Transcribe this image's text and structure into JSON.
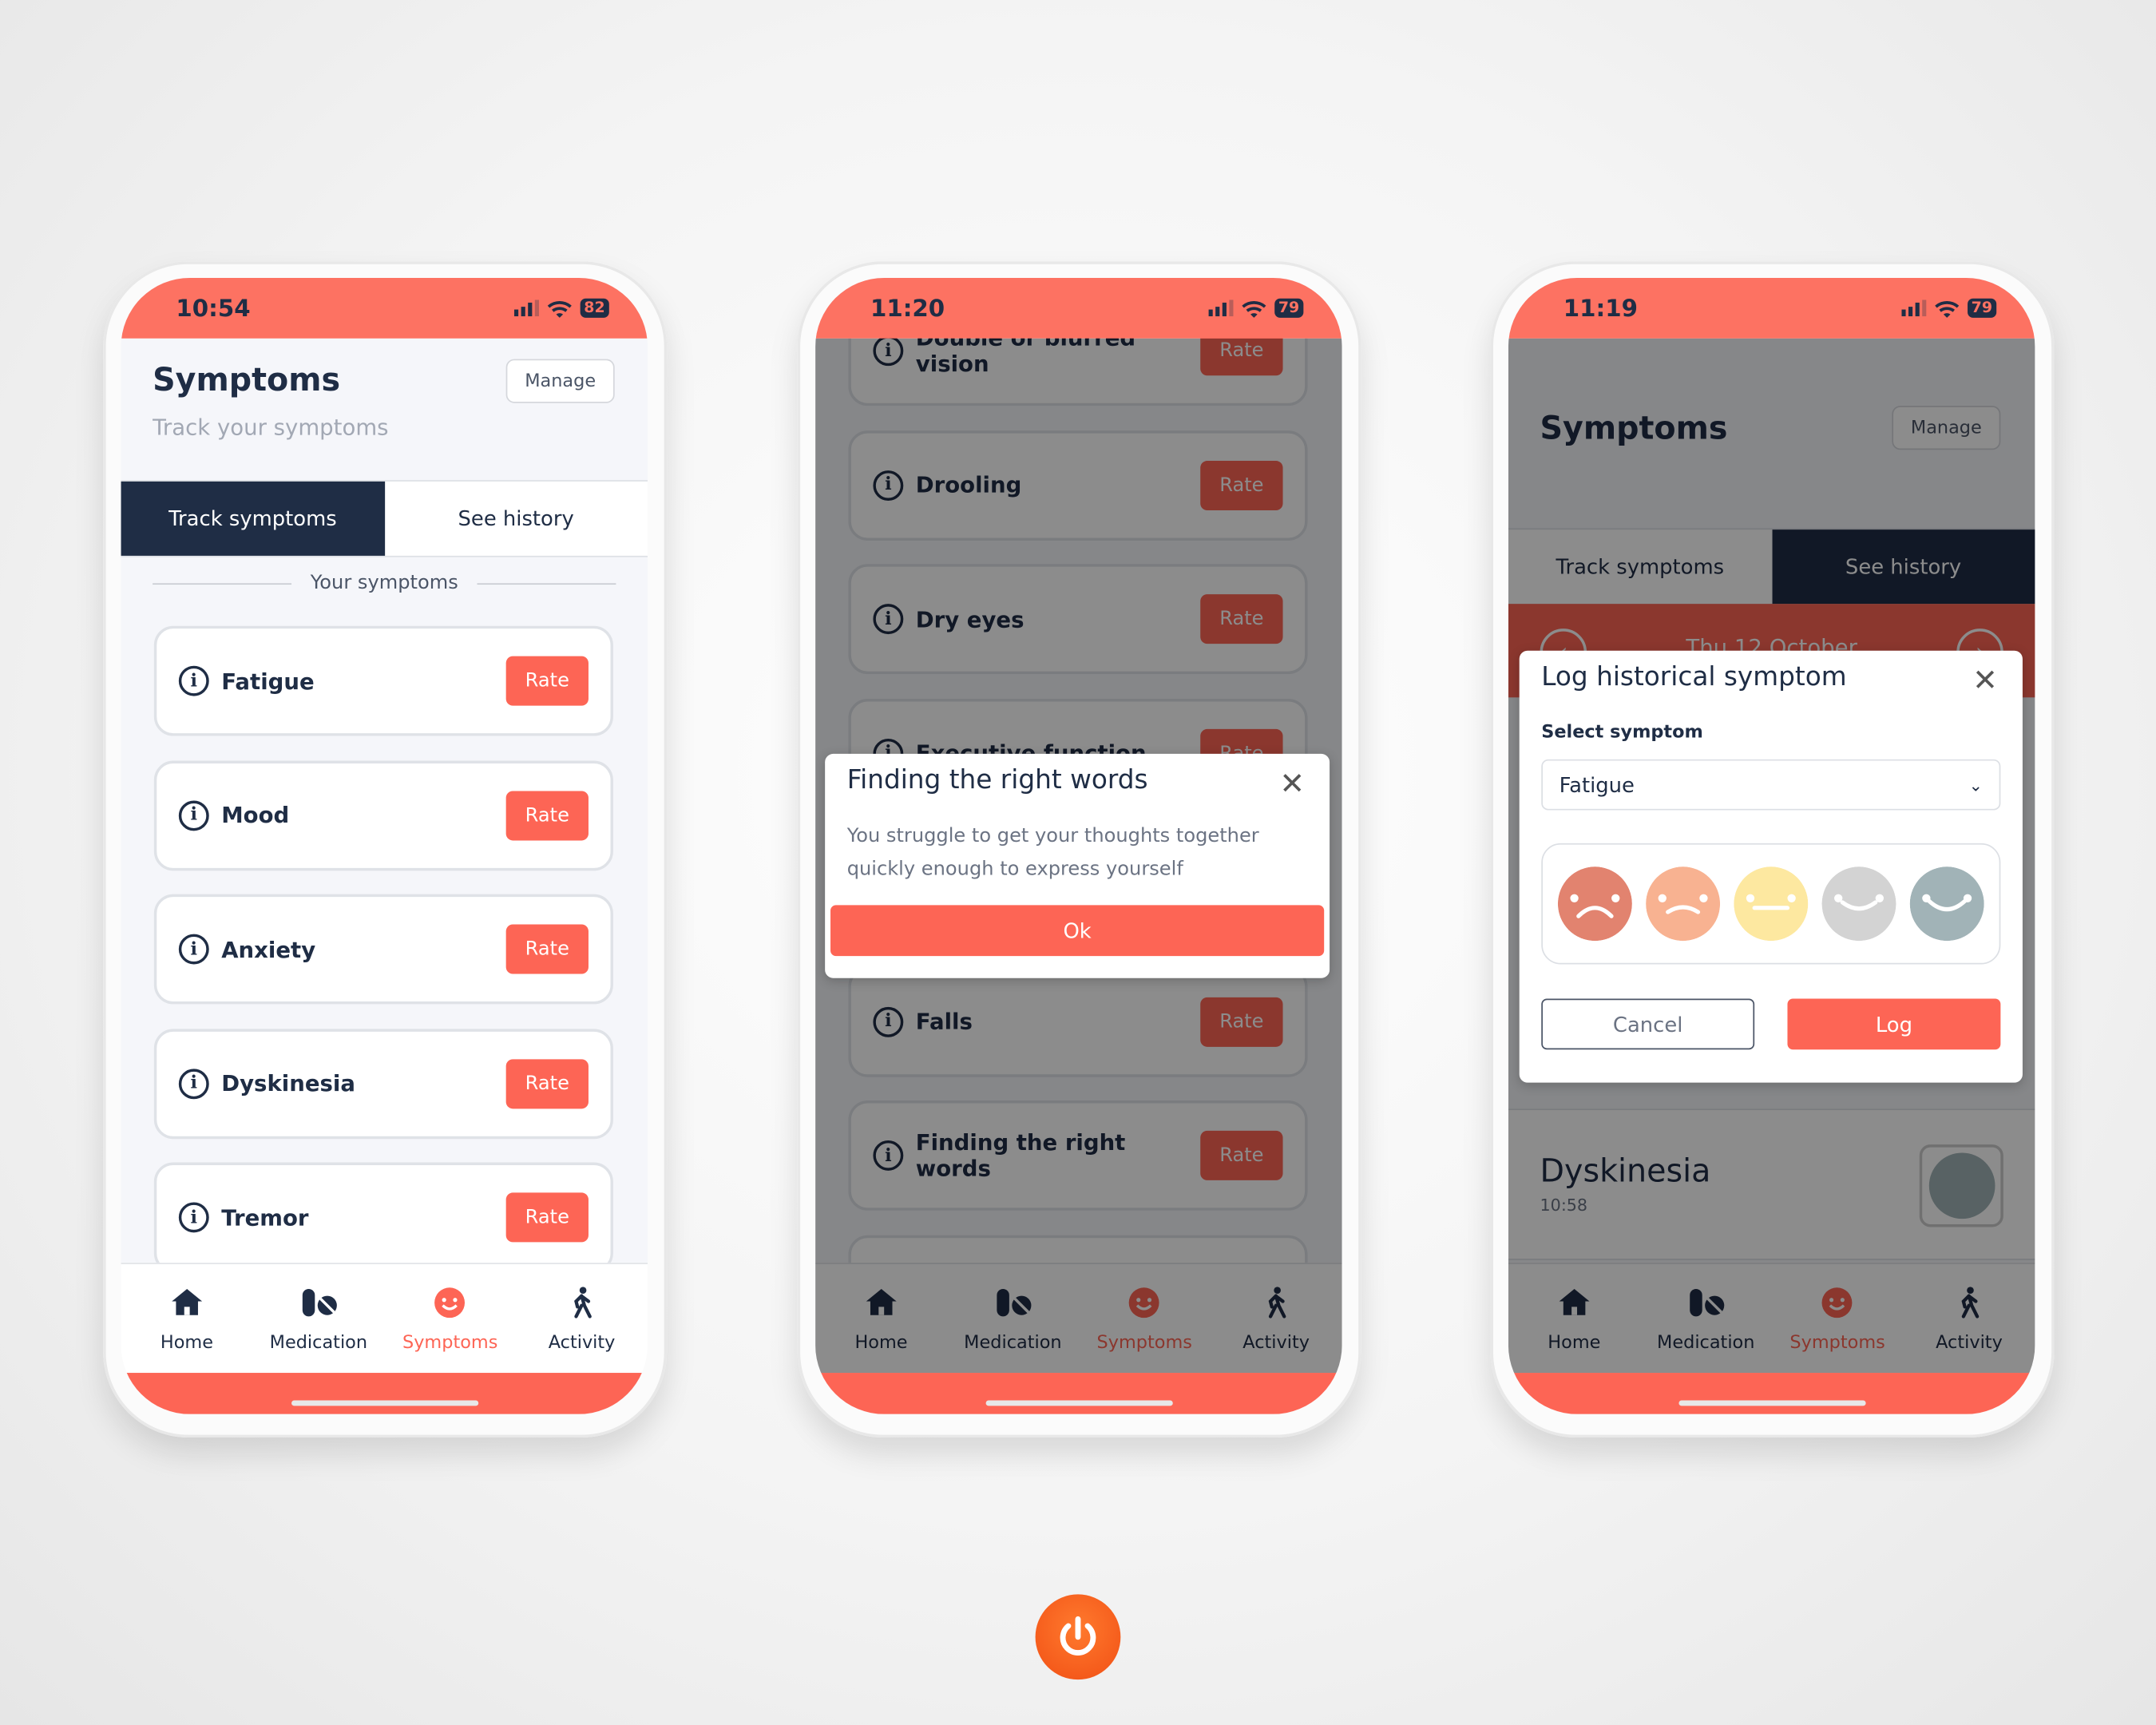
{
  "colors": {
    "accent": "#fd6555",
    "status_bar": "#fd7262",
    "navy": "#1f2d45"
  },
  "nav": [
    {
      "label": "Home",
      "icon": "home-icon"
    },
    {
      "label": "Medication",
      "icon": "pills-icon"
    },
    {
      "label": "Symptoms",
      "icon": "smiley-icon"
    },
    {
      "label": "Activity",
      "icon": "walking-icon"
    }
  ],
  "screen1": {
    "time": "10:54",
    "battery": "82",
    "title": "Symptoms",
    "subtitle": "Track your symptoms",
    "manage": "Manage",
    "tabs": [
      "Track symptoms",
      "See history"
    ],
    "active_tab": 0,
    "section": "Your symptoms",
    "rate": "Rate",
    "symptoms": [
      "Fatigue",
      "Mood",
      "Anxiety",
      "Dyskinesia",
      "Tremor"
    ]
  },
  "screen2": {
    "time": "11:20",
    "battery": "79",
    "rate": "Rate",
    "symptoms": [
      "Double or blurred vision",
      "Drooling",
      "Dry eyes",
      "Executive function",
      "",
      "Falls",
      "Finding the right words",
      ""
    ],
    "modal": {
      "title": "Finding the right words",
      "body": "You struggle to get your thoughts together quickly enough to express yourself",
      "ok": "Ok"
    }
  },
  "screen3": {
    "time": "11:19",
    "battery": "79",
    "title": "Symptoms",
    "manage": "Manage",
    "tabs": [
      "Track symptoms",
      "See history"
    ],
    "active_tab": 1,
    "date": "Thu 12 October",
    "history": [
      {
        "name": "Dyskinesia",
        "time": "10:58"
      }
    ],
    "modal": {
      "title": "Log historical symptom",
      "label": "Select symptom",
      "selected": "Fatigue",
      "ratings": [
        {
          "name": "very-bad",
          "color": "#e2836f"
        },
        {
          "name": "bad",
          "color": "#f8b291"
        },
        {
          "name": "neutral",
          "color": "#fde8a0"
        },
        {
          "name": "good",
          "color": "#d3d3d3"
        },
        {
          "name": "very-good",
          "color": "#a1b3b7"
        }
      ],
      "cancel": "Cancel",
      "log": "Log"
    }
  }
}
